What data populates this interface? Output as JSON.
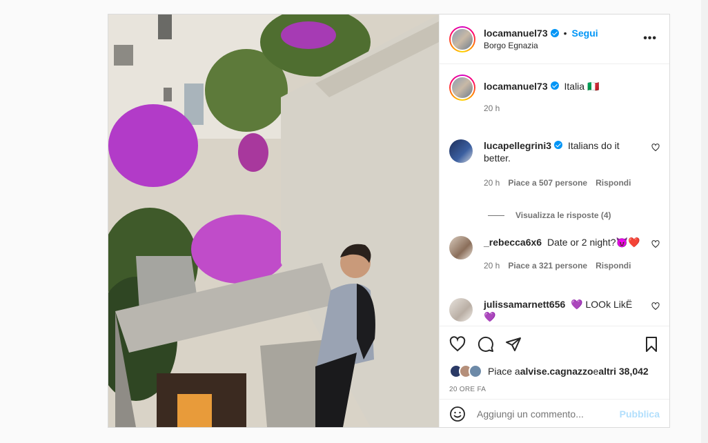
{
  "post": {
    "author": "locamanuel73",
    "follow_label": "Segui",
    "separator": "•",
    "location": "Borgo Egnazia",
    "more_label": "•••"
  },
  "caption": {
    "author": "locamanuel73",
    "text": "Italia 🇮🇹",
    "time": "20 h"
  },
  "comments": [
    {
      "author": "lucapellegrini3",
      "text": "Italians do it better.",
      "time": "20 h",
      "likes": "Piace a 507 persone",
      "reply_label": "Rispondi"
    },
    {
      "author": "_rebecca6x6",
      "text": "Date or 2 night?😈❤️",
      "time": "20 h",
      "likes": "Piace a 321 persone",
      "reply_label": "Rispondi"
    },
    {
      "author": "julissamarnett656",
      "text": "💜 LOOk LikË 💜"
    }
  ],
  "view_replies": "Visualizza le risposte (4)",
  "likes": {
    "prefix": "Piace a ",
    "user": "alvise.cagnazzo",
    "middle": " e ",
    "rest": "altri 38,042"
  },
  "timestamp": "20 ORE FA",
  "add_comment": {
    "placeholder": "Aggiungi un commento...",
    "publish_label": "Pubblica"
  },
  "colors": {
    "link_blue": "#0095f6",
    "publish_disabled": "#b2dffc",
    "muted": "#737373"
  }
}
